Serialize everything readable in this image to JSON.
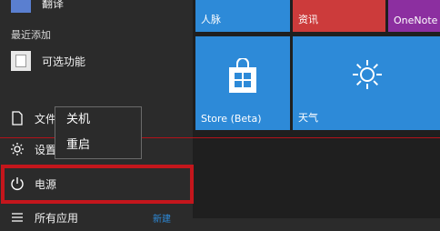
{
  "top_cut_label": "翻译",
  "recent_section_title": "最近添加",
  "recent_apps": [
    {
      "label": "可选功能",
      "icon": "optional-features-icon"
    }
  ],
  "system_items": {
    "file_label": "文件",
    "settings_label": "设置",
    "power_label": "电源",
    "all_apps_label": "所有应用"
  },
  "power_menu": {
    "items": [
      "关机",
      "重启"
    ]
  },
  "tiles": {
    "people": "人脉",
    "news": "资讯",
    "onenote": "OneNote",
    "store": "Store (Beta)",
    "weather": "天气"
  },
  "new_badge": "新建",
  "colors": {
    "tile_blue": "#2d8ad8",
    "tile_red": "#cc3b3b",
    "tile_purple": "#8c2fa0",
    "highlight_red": "#c4161c"
  }
}
